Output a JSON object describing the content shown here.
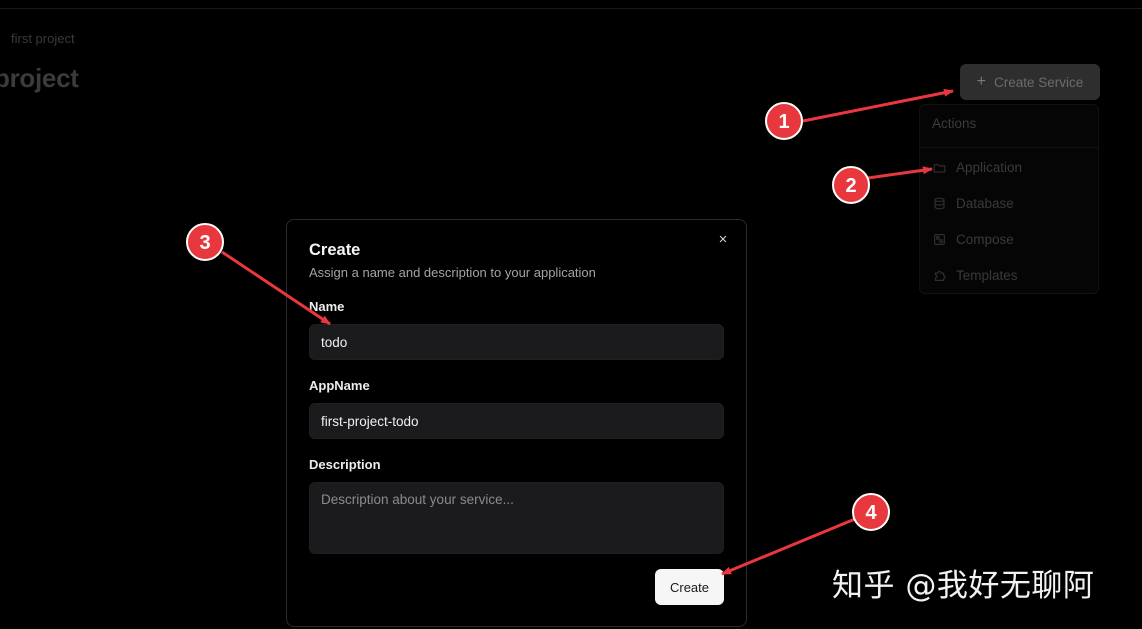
{
  "breadcrumb": "first project",
  "page_title": "project",
  "create_service_button": {
    "icon": "plus-icon",
    "label": "Create Service"
  },
  "actions_menu": {
    "title": "Actions",
    "items": [
      {
        "label": "Application",
        "icon": "folder-icon"
      },
      {
        "label": "Database",
        "icon": "database-icon"
      },
      {
        "label": "Compose",
        "icon": "compose-icon"
      },
      {
        "label": "Templates",
        "icon": "puzzle-icon"
      }
    ]
  },
  "modal": {
    "title": "Create",
    "description": "Assign a name and description to your application",
    "close_icon": "×",
    "fields": {
      "name": {
        "label": "Name",
        "value": "todo"
      },
      "appname": {
        "label": "AppName",
        "value": "first-project-todo"
      },
      "description": {
        "label": "Description",
        "value": "",
        "placeholder": "Description about your service..."
      }
    },
    "submit_label": "Create"
  },
  "annotations": {
    "color": "#e8383d",
    "markers": [
      "1",
      "2",
      "3",
      "4"
    ]
  },
  "watermark": "知乎 @我好无聊阿"
}
